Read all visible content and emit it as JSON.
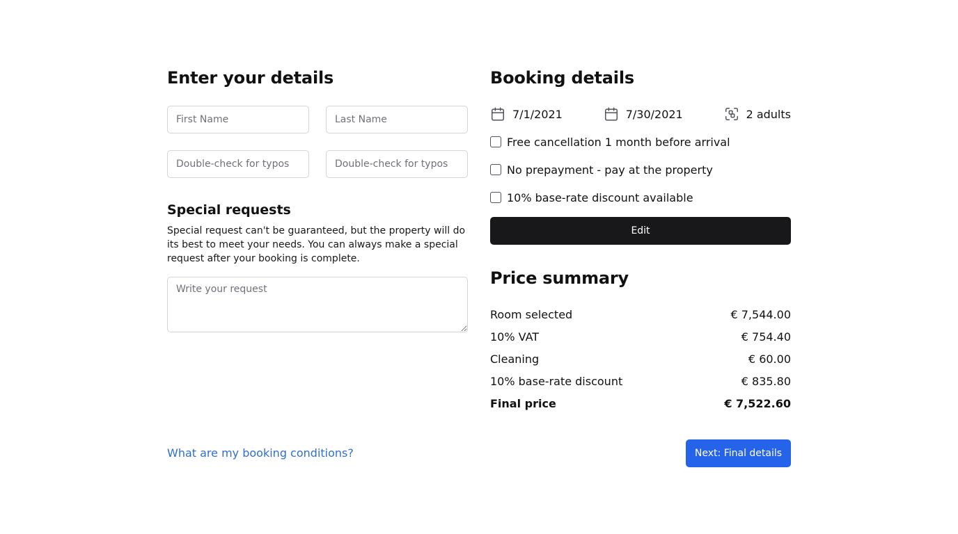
{
  "details": {
    "title": "Enter your details",
    "first_name_placeholder": "First Name",
    "last_name_placeholder": "Last Name",
    "first_confirm_placeholder": "Double-check for typos",
    "last_confirm_placeholder": "Double-check for typos"
  },
  "special_requests": {
    "title": "Special requests",
    "description": "Special request can't be guaranteed, but the property will do its best to meet your needs. You can always make a special request after your booking is complete.",
    "placeholder": "Write your request"
  },
  "booking": {
    "title": "Booking details",
    "check_in": "7/1/2021",
    "check_out": "7/30/2021",
    "guests": "2 adults",
    "check_in_icon": "calendar-icon",
    "check_out_icon": "calendar-icon",
    "guests_icon": "users-icon",
    "options": [
      {
        "label": "Free cancellation 1 month before arrival",
        "checked": false
      },
      {
        "label": "No prepayment - pay at the property",
        "checked": false
      },
      {
        "label": "10% base-rate discount available",
        "checked": false
      }
    ],
    "edit_label": "Edit"
  },
  "price_summary": {
    "title": "Price summary",
    "rows": [
      {
        "label": "Room selected",
        "value": "€ 7,544.00"
      },
      {
        "label": "10% VAT",
        "value": "€ 754.40"
      },
      {
        "label": "Cleaning",
        "value": "€ 60.00"
      },
      {
        "label": "10% base-rate discount",
        "value": "€ 835.80"
      }
    ],
    "final": {
      "label": "Final price",
      "value": "€ 7,522.60"
    }
  },
  "footer": {
    "conditions_link": "What are my booking conditions?",
    "next_label": "Next: Final details"
  },
  "colors": {
    "accent": "#2563eb",
    "link": "#2f6fd1",
    "dark_button": "#18181b",
    "input_border": "#d4d4d8"
  }
}
